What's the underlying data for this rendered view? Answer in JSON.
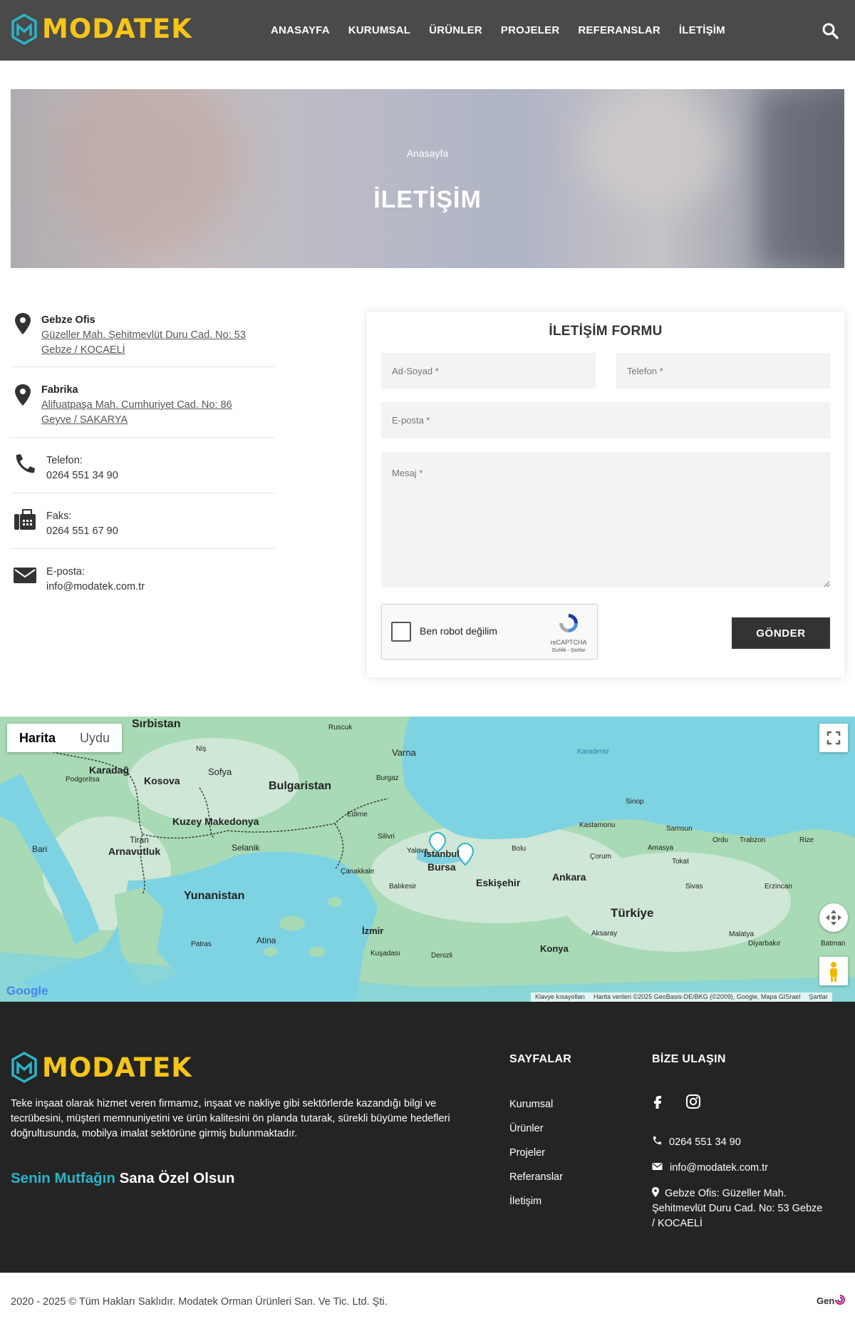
{
  "header": {
    "brand": "MODATEK",
    "nav": [
      "ANASAYFA",
      "KURUMSAL",
      "ÜRÜNLER",
      "PROJELER",
      "REFERANSLAR",
      "İLETİŞİM"
    ]
  },
  "hero": {
    "breadcrumb": "Anasayfa",
    "title": "İLETİŞİM"
  },
  "contact": {
    "gebze": {
      "title": "Gebze Ofis",
      "line1": "Güzeller Mah. Şehitmevlüt Duru Cad. No: 53",
      "line2": "Gebze / KOCAELİ"
    },
    "fabrika": {
      "title": "Fabrika",
      "line1": "Alifuatpaşa Mah. Cumhuriyet Cad. No: 86",
      "line2": "Geyve / SAKARYA"
    },
    "phone": {
      "label": "Telefon:",
      "value": "0264 551 34 90"
    },
    "fax": {
      "label": "Faks:",
      "value": "0264 551 67 90"
    },
    "email": {
      "label": "E-posta:",
      "value": "info@modatek.com.tr"
    }
  },
  "form": {
    "title": "İLETİŞİM FORMU",
    "name_placeholder": "Ad-Soyad *",
    "phone_placeholder": "Telefon *",
    "email_placeholder": "E-posta *",
    "message_placeholder": "Mesaj *",
    "captcha_label": "Ben robot değilim",
    "captcha_brand": "reCAPTCHA",
    "captcha_links": "Gizlilik - Şartlar",
    "submit": "GÖNDER"
  },
  "map": {
    "tabs": [
      "Harita",
      "Uydu"
    ],
    "labels": [
      {
        "t": "Sırbistan",
        "bold": true
      },
      {
        "t": "Bulgaristan",
        "bold": true
      },
      {
        "t": "Karadeniz",
        "bold": false
      },
      {
        "t": "Kosova",
        "bold": true
      },
      {
        "t": "Karadağ",
        "bold": true
      },
      {
        "t": "Kuzey Makedonya",
        "bold": true
      },
      {
        "t": "Arnavutluk",
        "bold": true
      },
      {
        "t": "Yunanistan",
        "bold": true
      },
      {
        "t": "Türkiye",
        "bold": true
      },
      {
        "t": "İstanbul",
        "bold": true
      },
      {
        "t": "Bursa",
        "bold": true
      },
      {
        "t": "Eskişehir",
        "bold": true
      },
      {
        "t": "Ankara",
        "bold": true
      },
      {
        "t": "İzmir",
        "bold": true
      },
      {
        "t": "Konya",
        "bold": true
      },
      {
        "t": "Sofya",
        "bold": false
      },
      {
        "t": "Varna",
        "bold": false
      },
      {
        "t": "Selanik",
        "bold": false
      },
      {
        "t": "Atina",
        "bold": false
      },
      {
        "t": "Samsun",
        "bold": false
      },
      {
        "t": "Sinop",
        "bold": false
      },
      {
        "t": "Trabzon",
        "bold": false
      },
      {
        "t": "Kastamonu",
        "bold": false
      },
      {
        "t": "Bolu",
        "bold": false
      },
      {
        "t": "Çorum",
        "bold": false
      },
      {
        "t": "Sivas",
        "bold": false
      },
      {
        "t": "Erzincan",
        "bold": false
      },
      {
        "t": "Malatya",
        "bold": false
      },
      {
        "t": "Aksaray",
        "bold": false
      },
      {
        "t": "Denizli",
        "bold": false
      },
      {
        "t": "Kuşadası",
        "bold": false
      },
      {
        "t": "Balıkesir",
        "bold": false
      },
      {
        "t": "Çanakkale",
        "bold": false
      },
      {
        "t": "Edirne",
        "bold": false
      },
      {
        "t": "Bari",
        "bold": false
      },
      {
        "t": "Tiran",
        "bold": false
      },
      {
        "t": "Patras",
        "bold": false
      },
      {
        "t": "Rize",
        "bold": false
      },
      {
        "t": "Ordu",
        "bold": false
      },
      {
        "t": "Tokat",
        "bold": false
      },
      {
        "t": "Amasya",
        "bold": false
      },
      {
        "t": "Yalova",
        "bold": false
      },
      {
        "t": "Silivri",
        "bold": false
      },
      {
        "t": "Burgaz",
        "bold": false
      },
      {
        "t": "Ruscuk",
        "bold": false
      },
      {
        "t": "Niş",
        "bold": false
      },
      {
        "t": "Podgoritsa",
        "bold": false
      },
      {
        "t": "Diyarbakır",
        "bold": false
      },
      {
        "t": "Batman",
        "bold": false
      }
    ],
    "footer_links": [
      "Klavye kısayolları",
      "Harita verileri ©2025 GeoBasis-DE/BKG (©2009), Google, Mapa GISrael",
      "Şartlar"
    ],
    "google": "Google"
  },
  "footer": {
    "brand": "MODATEK",
    "description": "Teke inşaat olarak hizmet veren firmamız, inşaat ve nakliye gibi sektörlerde kazandığı bilgi ve tecrübesini, müşteri memnuniyetini ve ürün kalitesini ön planda tutarak, sürekli büyüme hedefleri doğrultusunda, mobilya imalat sektörüne girmiş bulunmaktadır.",
    "slogan_accent": "Senin Mutfağın",
    "slogan_rest": "Sana Özel Olsun",
    "pages_title": "SAYFALAR",
    "pages": [
      "Kurumsal",
      "Ürünler",
      "Projeler",
      "Referanslar",
      "İletişim"
    ],
    "contact_title": "BİZE ULAŞIN",
    "phone": "0264 551 34 90",
    "email": "info@modatek.com.tr",
    "address": "Gebze Ofis: Güzeller Mah. Şehitmevlüt Duru Cad. No: 53 Gebze / KOCAELİ"
  },
  "bottom": {
    "copyright": "2020 - 2025 © Tüm Hakları Saklıdır. Modatek Orman Ürünleri San. Ve Tic. Ltd. Şti.",
    "credit": "Gen"
  },
  "colors": {
    "brand_yellow": "#f5c518",
    "accent_teal": "#2bb4c8",
    "header_bg": "#4a4a4a",
    "footer_bg": "#242424"
  }
}
